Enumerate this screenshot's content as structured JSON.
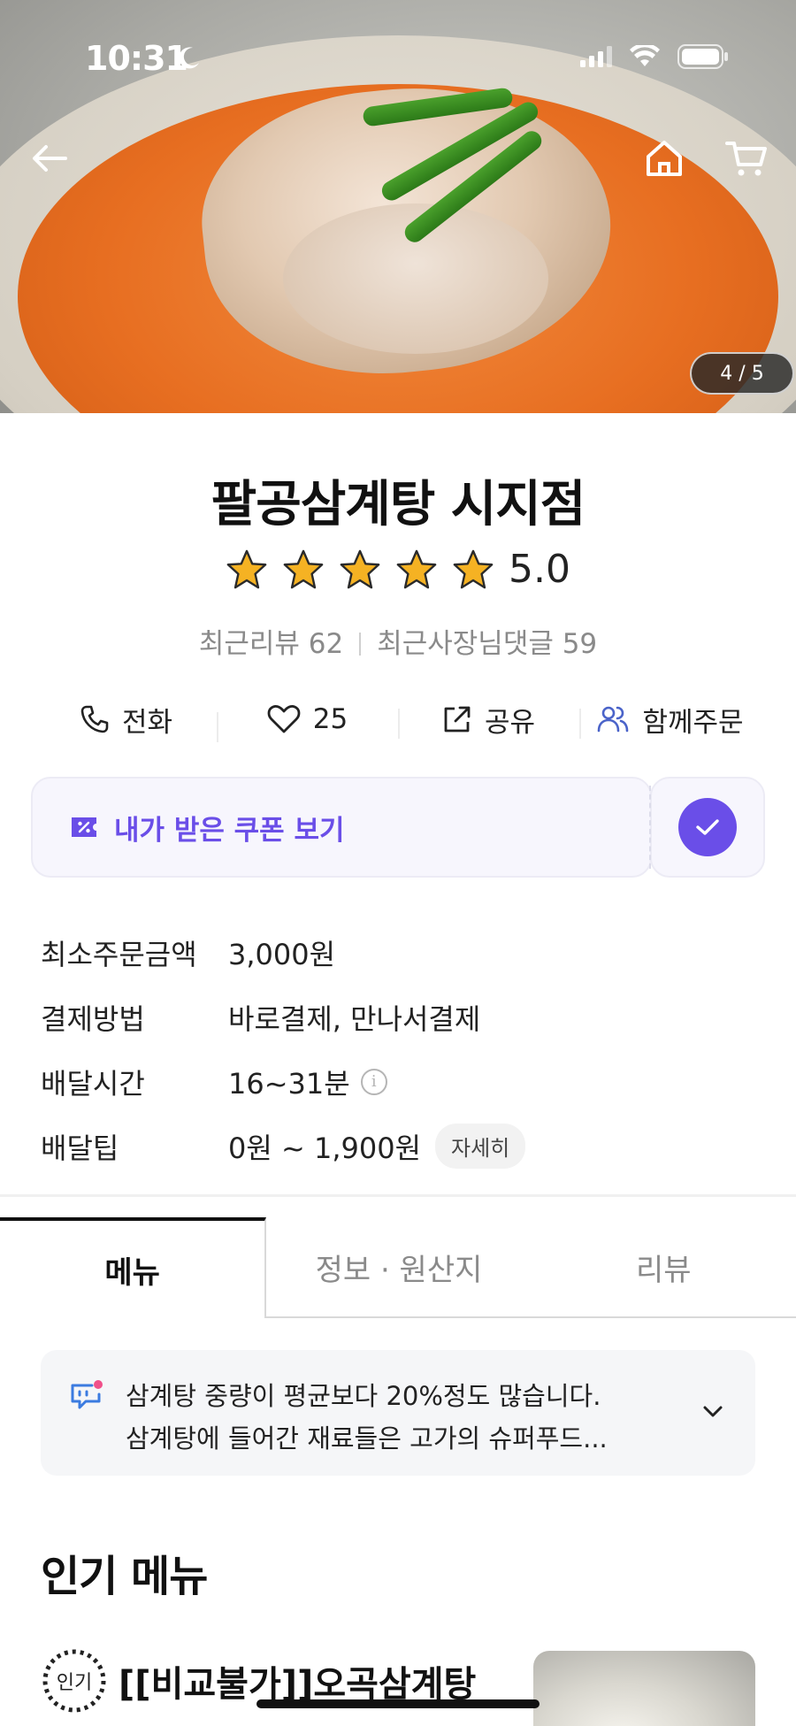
{
  "status_bar": {
    "time": "10:31"
  },
  "gallery": {
    "page_indicator": "4 / 5"
  },
  "store": {
    "name": "팔공삼계탕 시지점",
    "rating": "5.0",
    "rating_stars": 5,
    "recent_reviews": "최근리뷰 62",
    "owner_replies": "최근사장님댓글 59"
  },
  "actions": {
    "call": "전화",
    "likes": "25",
    "share": "공유",
    "group_order": "함께주문"
  },
  "coupon": {
    "label": "내가 받은 쿠폰 보기"
  },
  "info": [
    {
      "key": "최소주문금액",
      "value": "3,000원"
    },
    {
      "key": "결제방법",
      "value": "바로결제, 만나서결제"
    },
    {
      "key": "배달시간",
      "value": "16~31분"
    },
    {
      "key": "배달팁",
      "value": "0원 ~ 1,900원",
      "detail": "자세히"
    }
  ],
  "tabs": [
    {
      "label": "메뉴",
      "active": true
    },
    {
      "label": "정보 · 원산지",
      "active": false
    },
    {
      "label": "리뷰",
      "active": false
    }
  ],
  "notice": {
    "line1": "삼계탕 중량이 평균보다 20%정도 많습니다.",
    "line2": "삼계탕에 들어간 재료들은 고가의 슈퍼푸드..."
  },
  "popular": {
    "title": "인기 메뉴",
    "badge": "인기",
    "item_name": "[[비교불가]]오곡삼계탕"
  },
  "colors": {
    "accent": "#6a4ee8",
    "star": "#f5b223",
    "text": "#222222",
    "muted": "#8a8a8a"
  }
}
